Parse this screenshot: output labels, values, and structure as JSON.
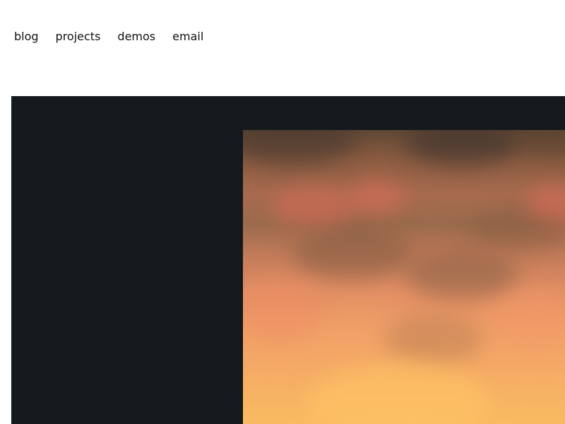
{
  "nav": {
    "items": [
      {
        "label": "blog"
      },
      {
        "label": "projects"
      },
      {
        "label": "demos"
      },
      {
        "label": "email"
      }
    ]
  },
  "colors": {
    "page_background": "#ffffff",
    "panel_background": "#15191c",
    "fire_top": "#5f4735",
    "fire_mid": "#e38f64",
    "fire_bottom": "#f9bb62"
  }
}
